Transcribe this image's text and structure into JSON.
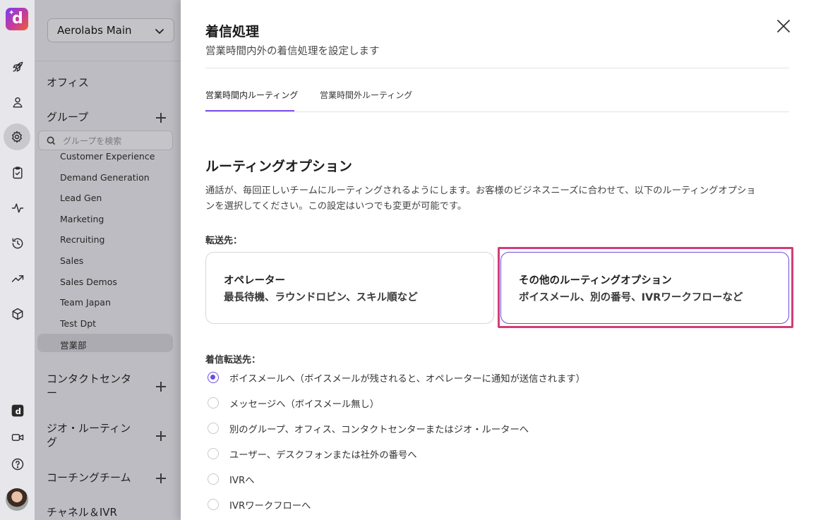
{
  "workspace": {
    "name": "Aerolabs Main"
  },
  "sidebar": {
    "office_label": "オフィス",
    "groups_label": "グループ",
    "group_search_placeholder": "グループを検索",
    "groups": [
      "Customer Experience",
      "Demand Generation",
      "Lead Gen",
      "Marketing",
      "Recruiting",
      "Sales",
      "Sales Demos",
      "Team Japan",
      "Test Dpt",
      "営業部"
    ],
    "selected_group": "営業部",
    "contact_center_label_1": "コンタクトセンタ",
    "contact_center_label_2": "ー",
    "geo_routing_label_1": "ジオ・ルーティン",
    "geo_routing_label_2": "グ",
    "coaching_label": "コーチングチーム",
    "channel_label": "チャネル＆IVR"
  },
  "rail": {
    "icons": [
      "rocket-icon",
      "person-icon",
      "gear-icon",
      "clipboard-icon",
      "activity-icon",
      "history-icon",
      "trending-icon",
      "box-icon",
      "dialpad-app-icon",
      "video-icon",
      "help-icon"
    ]
  },
  "panel": {
    "title": "着信処理",
    "subtitle": "営業時間内外の着信処理を設定します",
    "tabs": [
      {
        "label": "営業時間内ルーティング",
        "active": true
      },
      {
        "label": "営業時間外ルーティング",
        "active": false
      }
    ],
    "section_title": "ルーティングオプション",
    "description_line1": "通話が、毎回正しいチームにルーティングされるようにします。お客様のビジネスニーズに合わせて、以下のルーティングオプショ",
    "description_line2": "ンを選択してください。この設定はいつでも変更が可能です。",
    "forward_label": "転送先：",
    "cards": [
      {
        "title": "オペレーター",
        "desc": "最長待機、ラウンドロビン、スキル順など",
        "selected": false
      },
      {
        "title": "その他のルーティングオプション",
        "desc": "ボイスメール、別の番号、IVRワークフローなど",
        "selected": true
      }
    ],
    "incoming_label": "着信転送先：",
    "options": [
      {
        "label": "ボイスメールへ（ボイスメールが残されると、オペレーターに通知が送信されます）",
        "checked": true
      },
      {
        "label": "メッセージへ（ボイスメール無し）",
        "checked": false
      },
      {
        "label": "別のグループ、オフィス、コンタクトセンターまたはジオ・ルーターへ",
        "checked": false
      },
      {
        "label": "ユーザー、デスクフォンまたは社外の番号へ",
        "checked": false
      },
      {
        "label": "IVRへ",
        "checked": false
      },
      {
        "label": "IVRワークフローへ",
        "checked": false
      }
    ]
  },
  "colors": {
    "accent": "#6b4de0",
    "highlight": "#d23c78",
    "sidebar_bg": "#bdbcc2"
  }
}
